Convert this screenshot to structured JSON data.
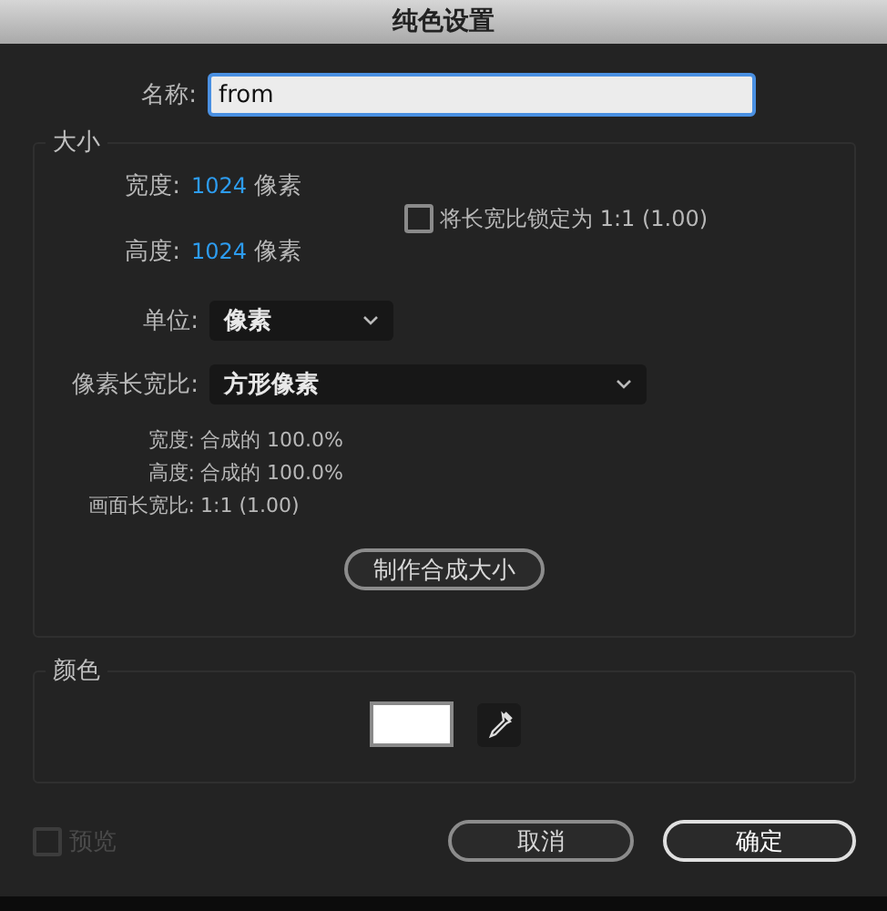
{
  "window": {
    "title": "纯色设置"
  },
  "name_field": {
    "label": "名称:",
    "value": "from"
  },
  "size": {
    "title": "大小",
    "width": {
      "label": "宽度:",
      "value": "1024",
      "unit": "像素"
    },
    "height": {
      "label": "高度:",
      "value": "1024",
      "unit": "像素"
    },
    "lock_aspect": {
      "label": "将长宽比锁定为 1:1 (1.00)",
      "checked": false
    },
    "unit_select": {
      "label": "单位:",
      "value": "像素"
    },
    "pixel_aspect_select": {
      "label": "像素长宽比:",
      "value": "方形像素"
    },
    "info": [
      {
        "label": "宽度:",
        "value": "合成的 100.0%"
      },
      {
        "label": "高度:",
        "value": "合成的 100.0%"
      },
      {
        "label": "画面长宽比:",
        "value": "1:1 (1.00)"
      }
    ],
    "make_comp_size_button": "制作合成大小"
  },
  "color": {
    "title": "颜色",
    "swatch": {
      "color": "#ffffff"
    }
  },
  "preview": {
    "label": "预览",
    "checked": false,
    "disabled": true
  },
  "buttons": [
    {
      "label": "取消",
      "kind": "secondary"
    },
    {
      "label": "确定",
      "kind": "primary"
    }
  ]
}
